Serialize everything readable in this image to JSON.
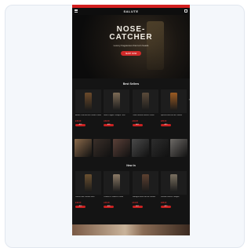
{
  "brand": {
    "logo": "SALUTE"
  },
  "hero": {
    "title_line1": "NOSE-",
    "title_line2": "CATCHER",
    "subtitle": "Luxury fragrances that turn heads",
    "cta": "SHOP NOW"
  },
  "sections": {
    "best_sellers": "Best Sellers",
    "new_in": "New In"
  },
  "best_sellers": [
    {
      "name": "Amber Oud Eau de Parfum 100ml",
      "price": "£45.00",
      "cta": "ADD",
      "color": "#6b4a2a"
    },
    {
      "name": "Black Pepper Cologne 75ml",
      "price": "£39.00",
      "cta": "ADD",
      "color": "#7c6a55"
    },
    {
      "name": "Cedar Smoke Intense 100ml",
      "price": "£49.00",
      "cta": "ADD",
      "color": "#5a4a3a"
    },
    {
      "name": "Spiced Rum Eau de Toilette",
      "price": "£35.00",
      "cta": "ADD",
      "color": "#9a5a22"
    }
  ],
  "tiles": [
    {
      "color": "#8a6a4a"
    },
    {
      "color": "#3a2f29"
    },
    {
      "color": "#5a4038"
    },
    {
      "color": "#4a4a4a"
    },
    {
      "color": "#2d2d2d"
    },
    {
      "color": "#6d6a66"
    }
  ],
  "new_in": [
    {
      "name": "Vetiver Noir Parfum 50ml",
      "price": "£42.00",
      "cta": "ADD",
      "color": "#6a5030"
    },
    {
      "name": "Leather & Tobacco 100ml",
      "price": "£46.00",
      "cta": "ADD",
      "color": "#8b7a66"
    },
    {
      "name": "Midnight Musk Eau de Parfum",
      "price": "£44.00",
      "cta": "ADD",
      "color": "#5b4030"
    },
    {
      "name": "Frosted Vetiver Cologne",
      "price": "£38.00",
      "cta": "ADD",
      "color": "#7a7060"
    }
  ]
}
